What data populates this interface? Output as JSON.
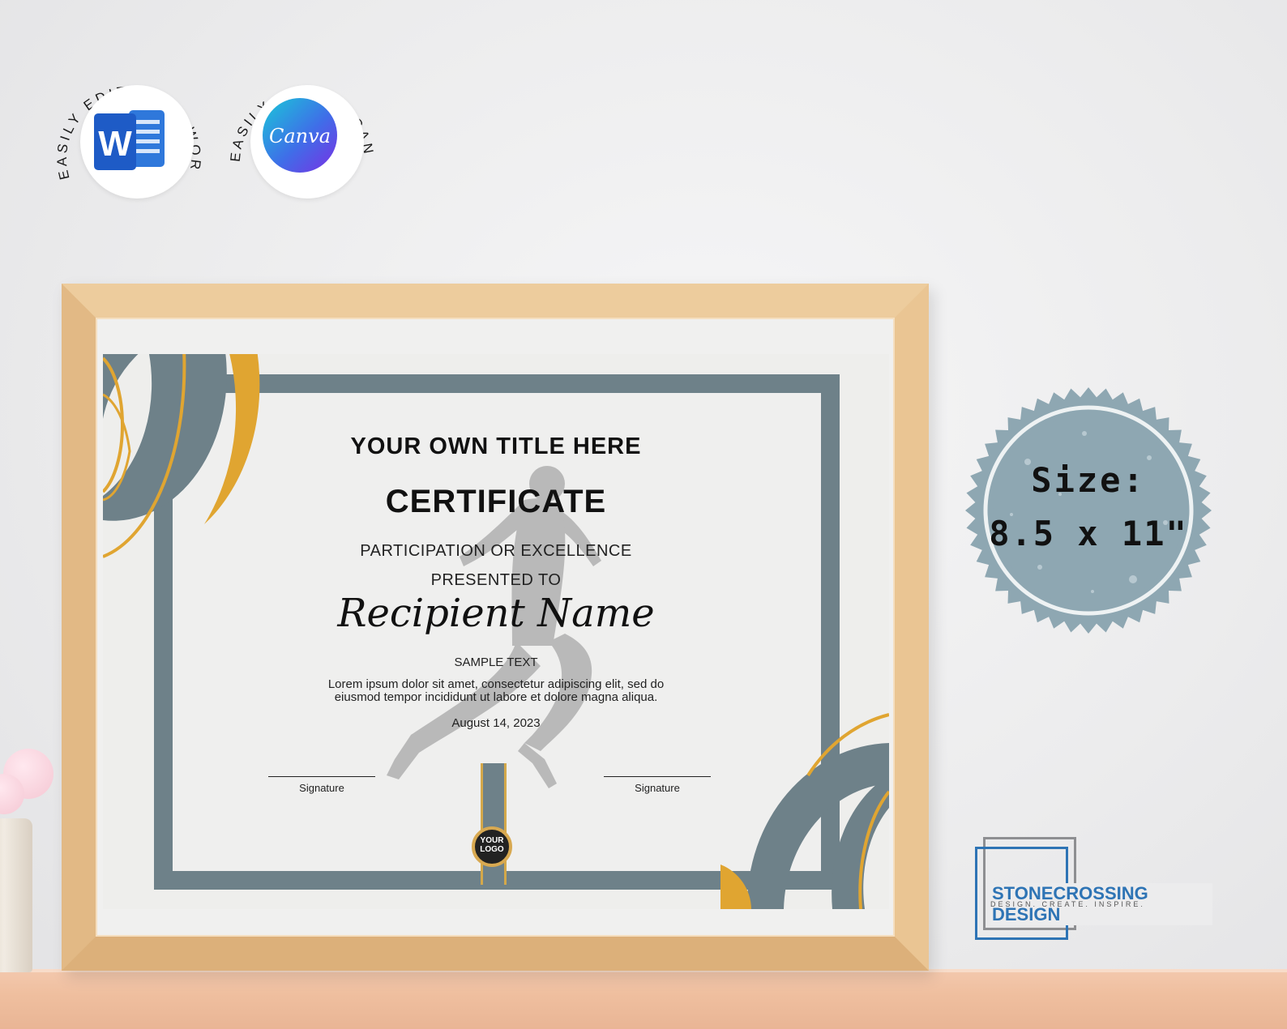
{
  "badges": {
    "word_caption": "EASILY EDIT IN MS WORD",
    "word_letter": "W",
    "canva_caption": "EASILY EDIT IN CANVA",
    "canva_logo": "Canva"
  },
  "certificate": {
    "title": "YOUR OWN TITLE HERE",
    "heading": "CERTIFICATE",
    "subheading": "PARTICIPATION OR EXCELLENCE",
    "presented": "PRESENTED TO",
    "recipient": "Recipient Name",
    "sample": "SAMPLE TEXT",
    "lorem_line1": "Lorem ipsum dolor sit amet, consectetur adipiscing elit, sed do",
    "lorem_line2": "eiusmod tempor incididunt ut labore et dolore magna aliqua.",
    "date": "August 14, 2023",
    "signature_left": "Signature",
    "signature_right": "Signature",
    "seal_line1": "YOUR",
    "seal_line2": "LOGO"
  },
  "size_stamp": {
    "line1": "Size:",
    "line2": "8.5 x 11\""
  },
  "brand": {
    "name": "STONECROSSING DESIGN",
    "tagline": "DESIGN. CREATE. INSPIRE."
  },
  "colors": {
    "slate": "#6e8189",
    "gold": "#e0a531",
    "stamp": "#8ea7b2",
    "brand_blue": "#2e74b5",
    "word_blue": "#1e5bc6"
  },
  "icons": [
    "ms-word-icon",
    "canva-icon",
    "runner-silhouette-icon",
    "seal-icon"
  ]
}
